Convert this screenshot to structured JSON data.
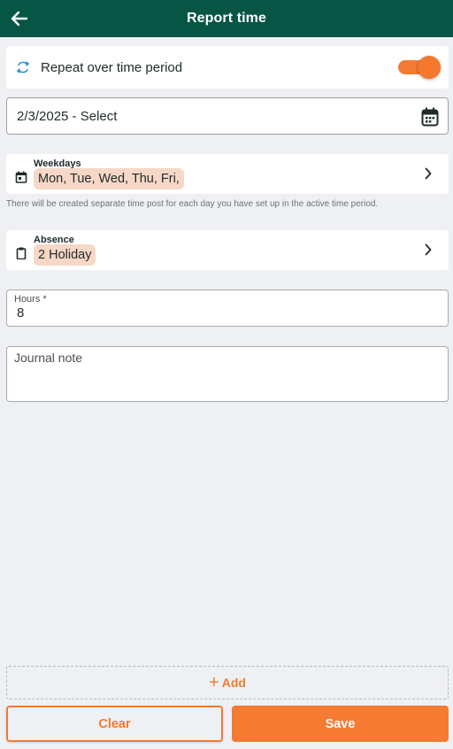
{
  "header": {
    "title": "Report time",
    "back_icon": "arrow-left-icon"
  },
  "repeat": {
    "label": "Repeat over time period",
    "icon": "repeat-icon",
    "enabled": true,
    "accent": "#f37a33"
  },
  "date_range": {
    "value": "2/3/2025 - Select",
    "icon": "calendar-icon"
  },
  "weekdays": {
    "label": "Weekdays",
    "value": "Mon, Tue, Wed, Thu, Fri,",
    "icon": "calendar-day-icon"
  },
  "hint": "There will be created separate time post for each day you have set up in the active time period.",
  "absence": {
    "label": "Absence",
    "value": "2 Holiday",
    "icon": "clipboard-icon"
  },
  "hours": {
    "label": "Hours *",
    "value": "8"
  },
  "journal": {
    "placeholder": "Journal note"
  },
  "actions": {
    "add": "Add",
    "clear": "Clear",
    "save": "Save"
  },
  "colors": {
    "header_bg": "#065545",
    "accent": "#f57a32",
    "chip_bg": "#f7d7c6"
  }
}
